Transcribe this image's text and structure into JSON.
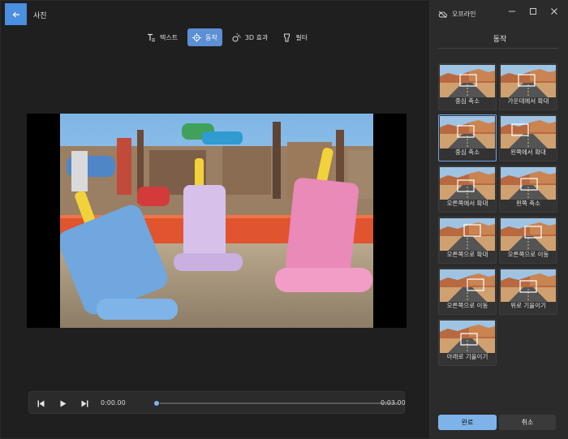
{
  "app": {
    "title": "사진"
  },
  "toolbar": {
    "items": [
      {
        "label": "텍스트",
        "icon": "text-icon",
        "active": false
      },
      {
        "label": "동작",
        "icon": "motion-icon",
        "active": true
      },
      {
        "label": "3D 효과",
        "icon": "3d-effects-icon",
        "active": false
      },
      {
        "label": "필터",
        "icon": "filter-icon",
        "active": false
      }
    ]
  },
  "playback": {
    "current_time": "0:00.00",
    "total_time": "0:03.00",
    "progress": 0
  },
  "panel": {
    "status": "오프라인",
    "title": "동작",
    "motions": [
      {
        "label": "중심 축소",
        "selected": false
      },
      {
        "label": "가운데에서 확대",
        "selected": false
      },
      {
        "label": "중심 축소",
        "selected": true
      },
      {
        "label": "왼쪽에서 확대",
        "selected": false
      },
      {
        "label": "오른쪽에서 확대",
        "selected": false
      },
      {
        "label": "왼쪽 축소",
        "selected": false
      },
      {
        "label": "오른쪽으로 확대",
        "selected": false
      },
      {
        "label": "오른쪽으로 이동",
        "selected": false
      },
      {
        "label": "오른쪽으로 이동",
        "selected": false
      },
      {
        "label": "위로 기울이기",
        "selected": false
      },
      {
        "label": "아래로 기울이기",
        "selected": false
      }
    ],
    "done_label": "완료",
    "cancel_label": "취소"
  },
  "colors": {
    "accent": "#5c8fd4",
    "accent_light": "#7eb3ea",
    "background": "#1f1f1f",
    "panel": "#2b2b2b"
  }
}
